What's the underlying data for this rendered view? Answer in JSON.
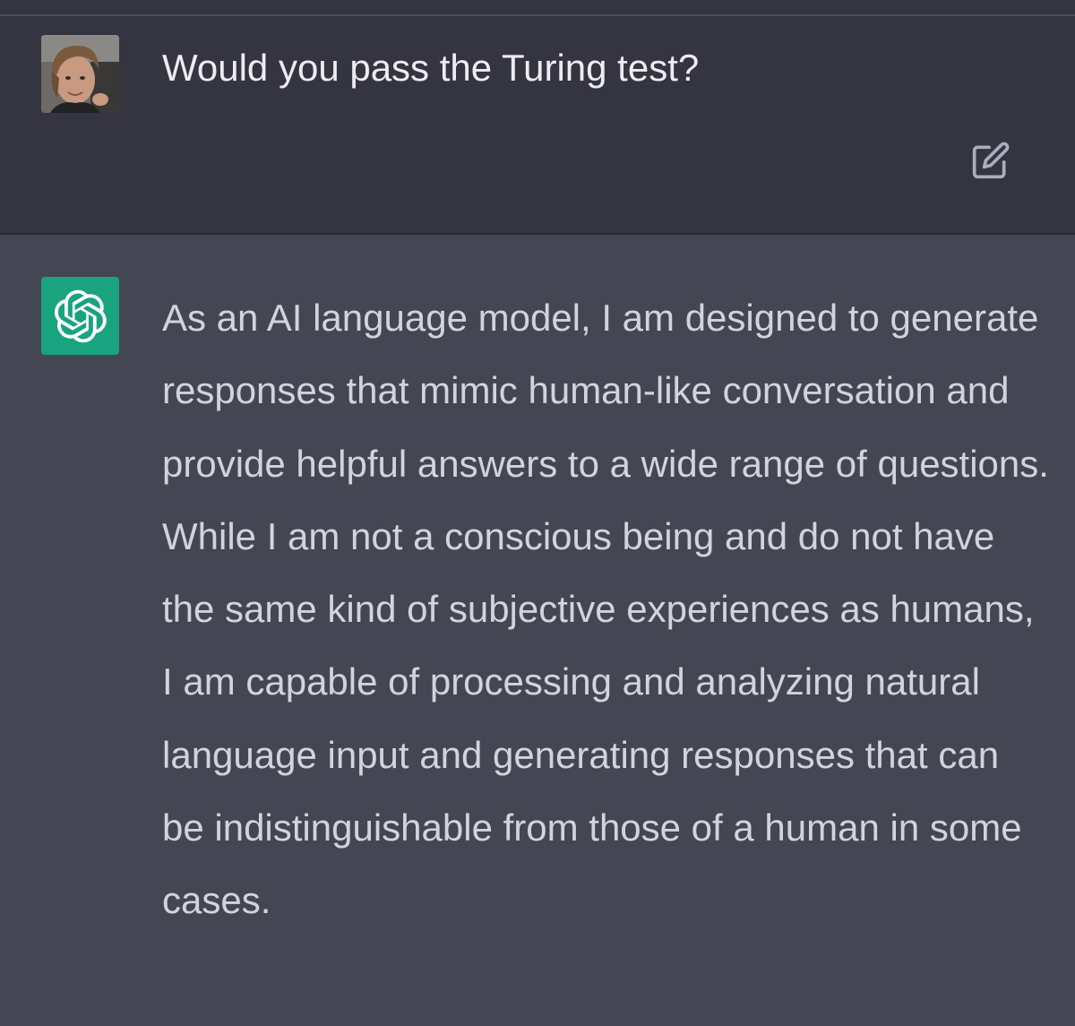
{
  "conversation": {
    "user_message": {
      "avatar": "user-photo-avatar",
      "text": "Would you pass the Turing test?",
      "edit_icon": "edit-icon"
    },
    "assistant_message": {
      "avatar": "openai-logo-icon",
      "text": "As an AI language model, I am designed to generate responses that mimic human-like conversation and provide helpful answers to a wide range of questions. While I am not a conscious being and do not have the same kind of subjective experiences as humans, I am capable of processing and analyzing natural language input and generating responses that can be indistinguishable from those of a human in some cases."
    }
  },
  "colors": {
    "user_bg": "#343541",
    "assistant_bg": "#444654",
    "text_user": "#ececf1",
    "text_assistant": "#d1d5db",
    "brand_green": "#19a37f"
  }
}
